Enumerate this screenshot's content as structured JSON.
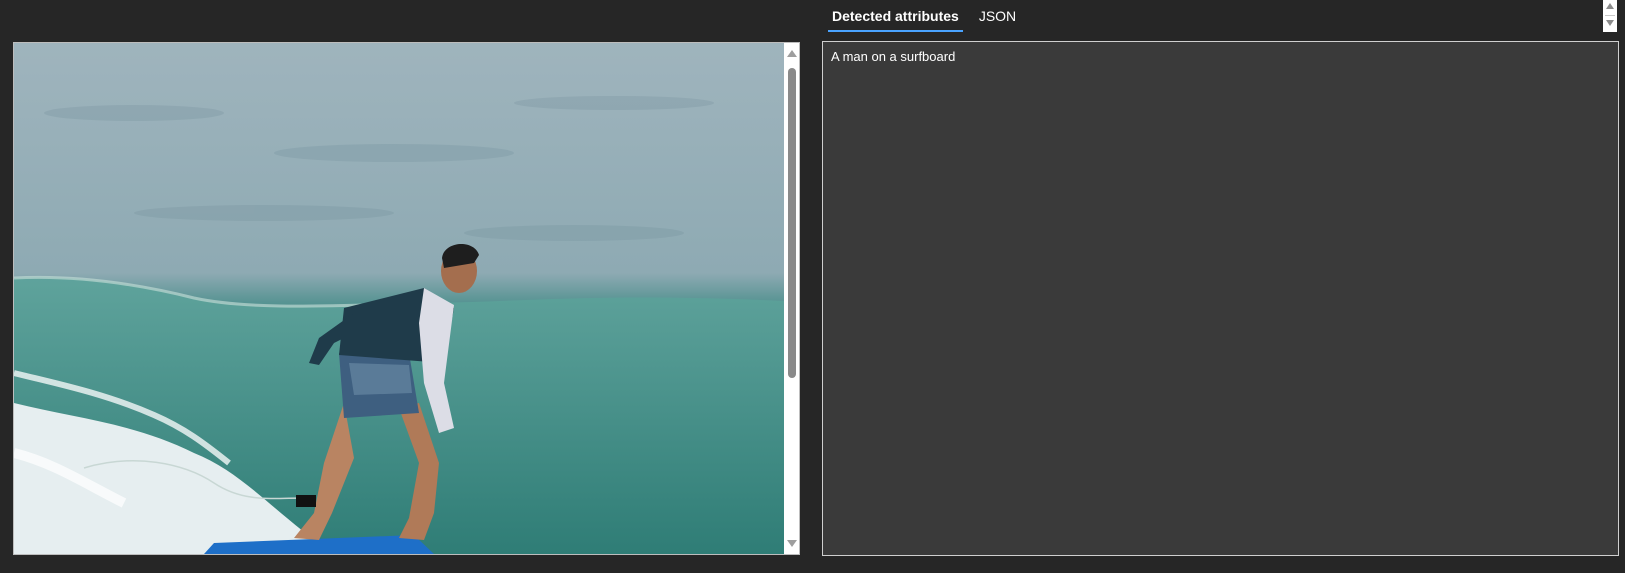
{
  "tabs": [
    {
      "label": "Detected attributes",
      "active": true
    },
    {
      "label": "JSON",
      "active": false
    }
  ],
  "result": {
    "caption": "A man on a surfboard"
  },
  "image": {
    "subject": "surfer-on-wave"
  },
  "colors": {
    "background": "#262626",
    "panel": "#3a3a3a",
    "accent": "#4aa3ff"
  }
}
